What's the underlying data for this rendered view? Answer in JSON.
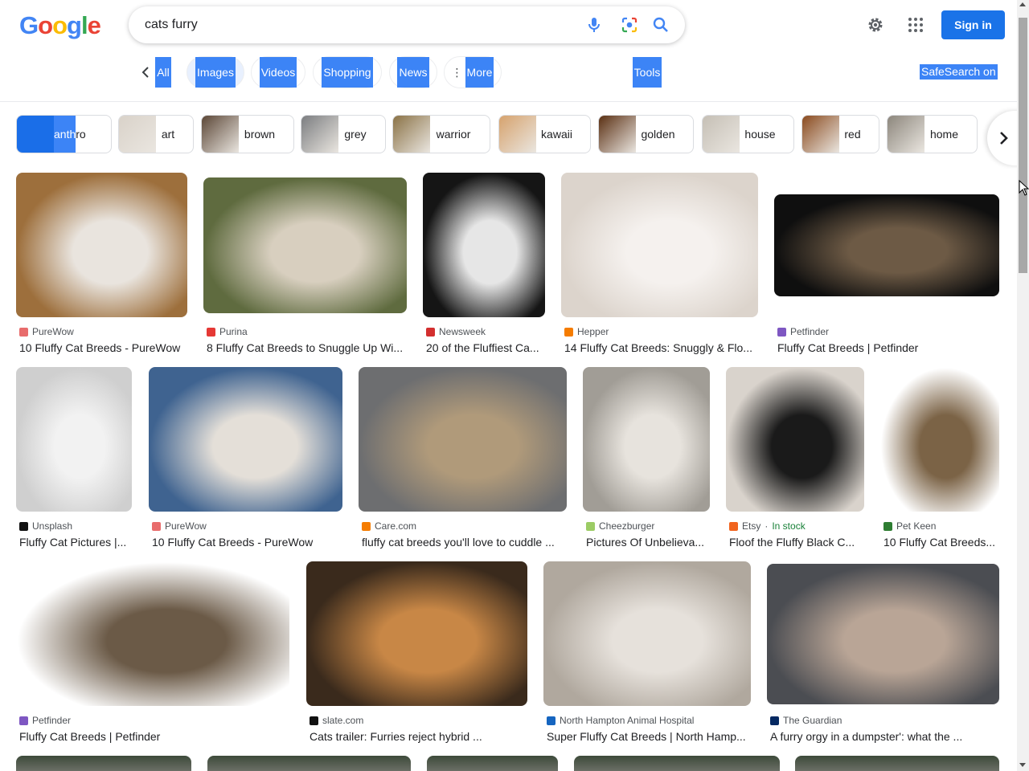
{
  "logo": {
    "letters": [
      "G",
      "o",
      "o",
      "g",
      "l",
      "e"
    ],
    "colors": [
      "#4285f4",
      "#ea4335",
      "#fbbc05",
      "#4285f4",
      "#34a853",
      "#ea4335"
    ]
  },
  "search": {
    "value": "cats furry",
    "icons": [
      "mic-icon",
      "lens-icon",
      "search-icon"
    ]
  },
  "header": {
    "signin_label": "Sign in",
    "icons": [
      "gear-icon",
      "apps-grid-icon"
    ]
  },
  "tabs": [
    {
      "label": "All"
    },
    {
      "label": "Images"
    },
    {
      "label": "Videos"
    },
    {
      "label": "Shopping"
    },
    {
      "label": "News"
    },
    {
      "label": "More"
    }
  ],
  "tools_label": "Tools",
  "safesearch_label": "SafeSearch on",
  "chips": [
    {
      "label": "anthro",
      "highlight": "anth",
      "rest": "ro",
      "color": "#1a6ee8"
    },
    {
      "label": "art",
      "color": "#d9d2c9"
    },
    {
      "label": "brown",
      "color": "#5b4636"
    },
    {
      "label": "grey",
      "color": "#7b7d80"
    },
    {
      "label": "warrior",
      "color": "#8a7246"
    },
    {
      "label": "kawaii",
      "color": "#d6a26d"
    },
    {
      "label": "golden",
      "color": "#5a2f12"
    },
    {
      "label": "house",
      "color": "#c5bfb5"
    },
    {
      "label": "red",
      "color": "#8a4a1e"
    },
    {
      "label": "home",
      "color": "#8c867c"
    }
  ],
  "colors": {
    "accent": "#1a73e8",
    "highlight": "#3c84f6"
  },
  "results": [
    {
      "source": "PureWow",
      "title": "10 Fluffy Cat Breeds - PureWow",
      "fav": "#e86c6c",
      "tone": [
        "#9d6f3c",
        "#e9e4de"
      ]
    },
    {
      "source": "Purina",
      "title": "8 Fluffy Cat Breeds to Snuggle Up Wi...",
      "fav": "#e53935",
      "tone": [
        "#5f6b3f",
        "#d8cfbf"
      ]
    },
    {
      "source": "Newsweek",
      "title": "20 of the Fluffiest Ca...",
      "fav": "#d32f2f",
      "tone": [
        "#151515",
        "#e6e6e6"
      ]
    },
    {
      "source": "Hepper",
      "title": "14 Fluffy Cat Breeds: Snuggly & Flo...",
      "fav": "#f57c00",
      "tone": [
        "#dcd4cc",
        "#f5f1ee"
      ]
    },
    {
      "source": "Petfinder",
      "title": "Fluffy Cat Breeds | Petfinder",
      "fav": "#7e57c2",
      "tone": [
        "#0f0f0f",
        "#6d5a45"
      ]
    },
    {
      "source": "Unsplash",
      "title": "Fluffy Cat Pictures |...",
      "fav": "#111111",
      "tone": [
        "#cfcfcf",
        "#f2f2f2"
      ]
    },
    {
      "source": "PureWow",
      "title": "10 Fluffy Cat Breeds - PureWow",
      "fav": "#e86c6c",
      "tone": [
        "#3f6390",
        "#e4dfd8"
      ]
    },
    {
      "source": "Care.com",
      "title": "fluffy cat breeds you'll love to cuddle ...",
      "fav": "#f57c00",
      "tone": [
        "#6d6e70",
        "#b09a7a"
      ]
    },
    {
      "source": "Cheezburger",
      "title": "Pictures Of Unbelieva...",
      "fav": "#9ccc65",
      "tone": [
        "#a19d96",
        "#e7e3dd"
      ]
    },
    {
      "source": "Etsy",
      "stock": "In stock",
      "title": "Floof the Fluffy Black C...",
      "fav": "#f1641e",
      "tone": [
        "#d9d3cc",
        "#1a1a1a"
      ]
    },
    {
      "source": "Pet Keen",
      "title": "10 Fluffy Cat Breeds...",
      "fav": "#2e7d32",
      "tone": [
        "#ffffff",
        "#7b6346"
      ]
    },
    {
      "source": "Petfinder",
      "title": "Fluffy Cat Breeds | Petfinder",
      "fav": "#7e57c2",
      "tone": [
        "#ffffff",
        "#6b5a47"
      ]
    },
    {
      "source": "slate.com",
      "title": "Cats trailer: Furries reject hybrid ...",
      "fav": "#111111",
      "tone": [
        "#3a2a1c",
        "#c88746"
      ]
    },
    {
      "source": "North Hampton Animal Hospital",
      "title": "Super Fluffy Cat Breeds | North Hamp...",
      "fav": "#1565c0",
      "tone": [
        "#b0a89e",
        "#e6e1db"
      ]
    },
    {
      "source": "The Guardian",
      "title": "A furry orgy in a dumpster': what the ...",
      "fav": "#052962",
      "tone": [
        "#4b4d52",
        "#b9a596"
      ]
    }
  ]
}
